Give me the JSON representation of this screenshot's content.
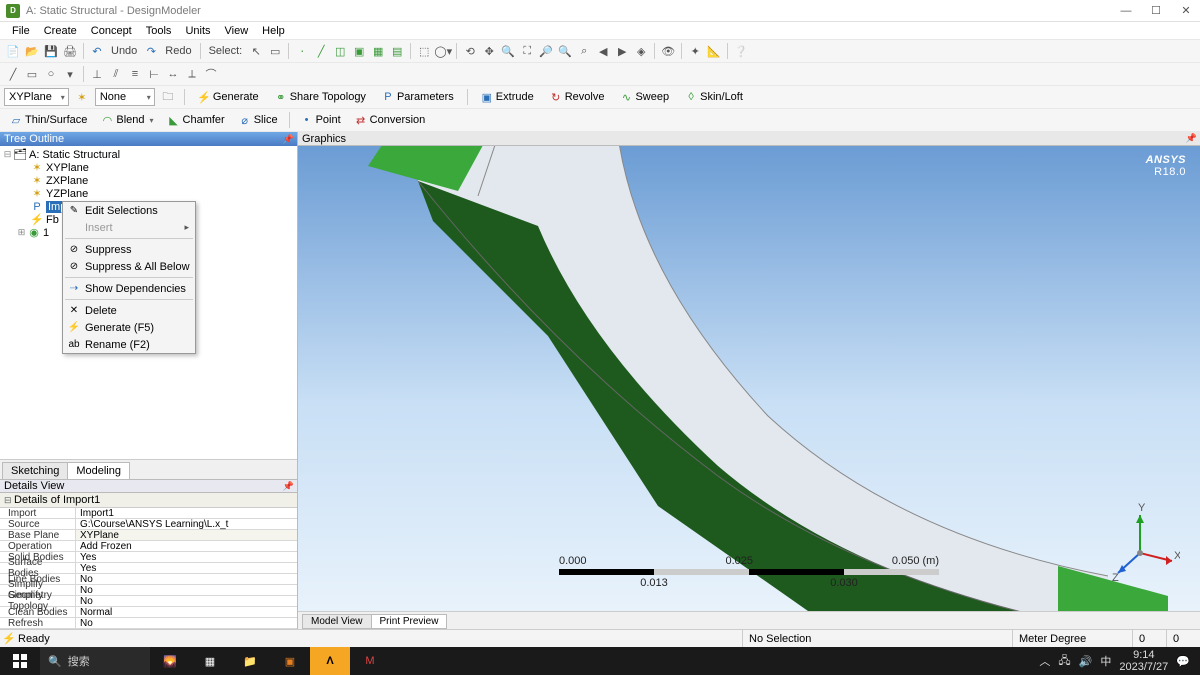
{
  "window": {
    "title": "A: Static Structural - DesignModeler"
  },
  "menu": {
    "items": [
      "File",
      "Create",
      "Concept",
      "Tools",
      "Units",
      "View",
      "Help"
    ]
  },
  "toolbar1": {
    "undo": "Undo",
    "redo": "Redo",
    "select_label": "Select:"
  },
  "planes": {
    "plane": "XYPlane",
    "sketch": "None"
  },
  "ops": {
    "generate": "Generate",
    "share": "Share Topology",
    "params": "Parameters",
    "extrude": "Extrude",
    "revolve": "Revolve",
    "sweep": "Sweep",
    "skin": "Skin/Loft",
    "thin": "Thin/Surface",
    "blend": "Blend",
    "chamfer": "Chamfer",
    "slice": "Slice",
    "point": "Point",
    "conversion": "Conversion"
  },
  "tree": {
    "header": "Tree Outline",
    "root": "A: Static Structural",
    "xy": "XYPlane",
    "zx": "ZXPlane",
    "yz": "YZPlane",
    "import": "Import1",
    "fb": "Fb",
    "parts": "1 "
  },
  "context": {
    "edit": "Edit Selections",
    "insert": "Insert",
    "suppress": "Suppress",
    "suppress_all": "Suppress & All Below",
    "deps": "Show Dependencies",
    "delete": "Delete",
    "generate": "Generate (F5)",
    "rename": "Rename (F2)"
  },
  "tabs": {
    "sketch": "Sketching",
    "model": "Modeling"
  },
  "details": {
    "header": "Details View",
    "group": "Details of Import1",
    "rows": [
      {
        "k": "Import",
        "v": "Import1"
      },
      {
        "k": "Source",
        "v": "G:\\Course\\ANSYS Learning\\L.x_t"
      },
      {
        "k": "Base Plane",
        "v": "XYPlane",
        "hl": true
      },
      {
        "k": "Operation",
        "v": "Add Frozen"
      },
      {
        "k": "Solid Bodies",
        "v": "Yes"
      },
      {
        "k": "Surface Bodies",
        "v": "Yes"
      },
      {
        "k": "Line Bodies",
        "v": "No"
      },
      {
        "k": "Simplify Geometry",
        "v": "No"
      },
      {
        "k": "Simplify Topology",
        "v": "No"
      },
      {
        "k": "Clean Bodies",
        "v": "Normal"
      },
      {
        "k": "Refresh",
        "v": "No"
      }
    ]
  },
  "graphics": {
    "header": "Graphics",
    "brand": "ANSYS",
    "version": "R18.0",
    "scale": {
      "t0": "0.000",
      "t1": "0.025",
      "t2": "0.050 (m)",
      "s1": "0.013",
      "s2": "0.030"
    },
    "tabs": {
      "model": "Model View",
      "print": "Print Preview"
    }
  },
  "status": {
    "ready": "Ready",
    "sel": "No Selection",
    "units": "Meter Degree",
    "a": "0",
    "b": "0"
  },
  "taskbar": {
    "search": "搜索",
    "time": "9:14",
    "date": "2023/7/27"
  }
}
